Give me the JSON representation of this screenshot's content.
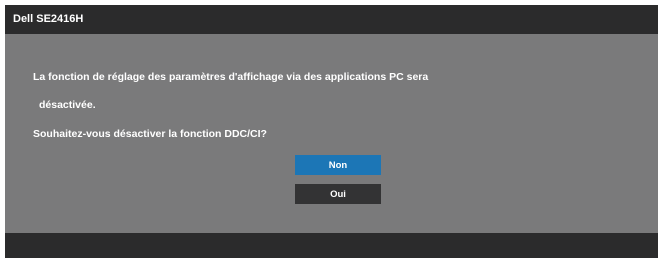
{
  "osd": {
    "title": "Dell SE2416H",
    "message_line1": "La fonction de réglage des paramètres d'affichage via des applications PC sera",
    "message_line2": "désactivée.",
    "question": "Souhaitez-vous désactiver la fonction DDC/CI?",
    "buttons": {
      "non": {
        "label": "Non",
        "selected": true
      },
      "oui": {
        "label": "Oui",
        "selected": false
      }
    }
  },
  "colors": {
    "panel_bg": "#7a7a7b",
    "bar_bg": "#2b2b2c",
    "selected_button": "#1c76b6",
    "unselected_button": "#333334",
    "text": "#ffffff"
  }
}
